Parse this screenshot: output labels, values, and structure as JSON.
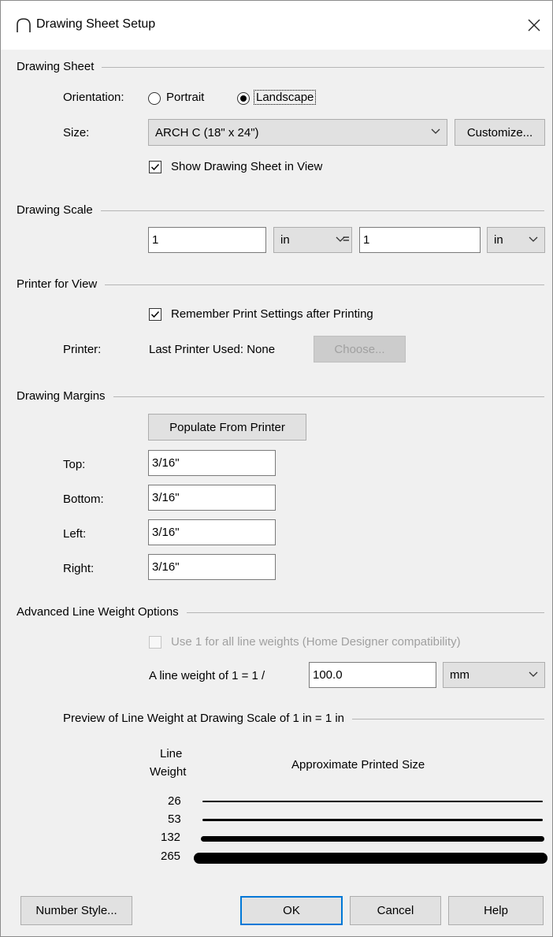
{
  "window": {
    "title": "Drawing Sheet Setup"
  },
  "drawing_sheet": {
    "section_label": "Drawing Sheet",
    "orientation_label": "Orientation:",
    "portrait_label": "Portrait",
    "landscape_label": "Landscape",
    "selected_orientation": "Landscape",
    "size_label": "Size:",
    "size_value": "ARCH C  (18\" x 24\")",
    "customize_label": "Customize...",
    "show_sheet_label": "Show Drawing Sheet in View",
    "show_sheet_checked": true
  },
  "drawing_scale": {
    "section_label": "Drawing Scale",
    "left_value": "1",
    "left_unit": "in",
    "equals": "=",
    "right_value": "1",
    "right_unit": "in"
  },
  "printer": {
    "section_label": "Printer for View",
    "remember_label": "Remember Print Settings after Printing",
    "remember_checked": true,
    "printer_label": "Printer:",
    "last_printer": "Last Printer Used: None",
    "choose_label": "Choose..."
  },
  "margins": {
    "section_label": "Drawing Margins",
    "populate_label": "Populate From Printer",
    "top_label": "Top:",
    "top_value": "3/16\"",
    "bottom_label": "Bottom:",
    "bottom_value": "3/16\"",
    "left_label": "Left:",
    "left_value": "3/16\"",
    "right_label": "Right:",
    "right_value": "3/16\""
  },
  "line_weight": {
    "section_label": "Advanced Line Weight Options",
    "use_one_label": "Use 1 for all line weights (Home Designer compatibility)",
    "use_one_checked": false,
    "weight_of_label": "A line weight of 1 = 1 /",
    "weight_value": "100.0",
    "weight_unit": "mm",
    "preview_label": "Preview of Line Weight at Drawing Scale of  1 in = 1 in",
    "col_weight_1": "Line",
    "col_weight_2": "Weight",
    "col_size": "Approximate Printed Size",
    "rows": [
      {
        "weight": "26"
      },
      {
        "weight": "53"
      },
      {
        "weight": "132"
      },
      {
        "weight": "265"
      }
    ]
  },
  "footer": {
    "number_style_label": "Number Style...",
    "ok_label": "OK",
    "cancel_label": "Cancel",
    "help_label": "Help"
  }
}
